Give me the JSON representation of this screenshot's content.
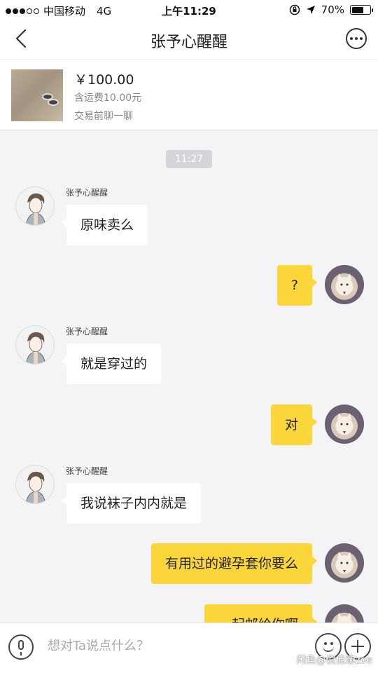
{
  "status_bar": {
    "carrier": "中国移动",
    "network": "4G",
    "time": "上午11:29",
    "battery": "70%",
    "battery_level": 0.7
  },
  "nav": {
    "title": "张予心醒醒"
  },
  "product": {
    "price": "￥100.00",
    "shipping": "含运费10.00元",
    "note": "交易前聊一聊"
  },
  "chat": {
    "timestamp": "11:27",
    "messages": [
      {
        "sender": "张予心醒醒",
        "text": "原味卖么"
      },
      {
        "text": "?"
      },
      {
        "sender": "张予心醒醒",
        "text": "就是穿过的"
      },
      {
        "text": "对"
      },
      {
        "sender": "张予心醒醒",
        "text": "我说袜子内内就是"
      },
      {
        "text": "有用过的避孕套你要么"
      },
      {
        "text": "一起邮给你啊"
      }
    ]
  },
  "input": {
    "placeholder": "想对Ta说点什么？",
    "watermark": "闲鱼@倪佳璇zoe"
  }
}
